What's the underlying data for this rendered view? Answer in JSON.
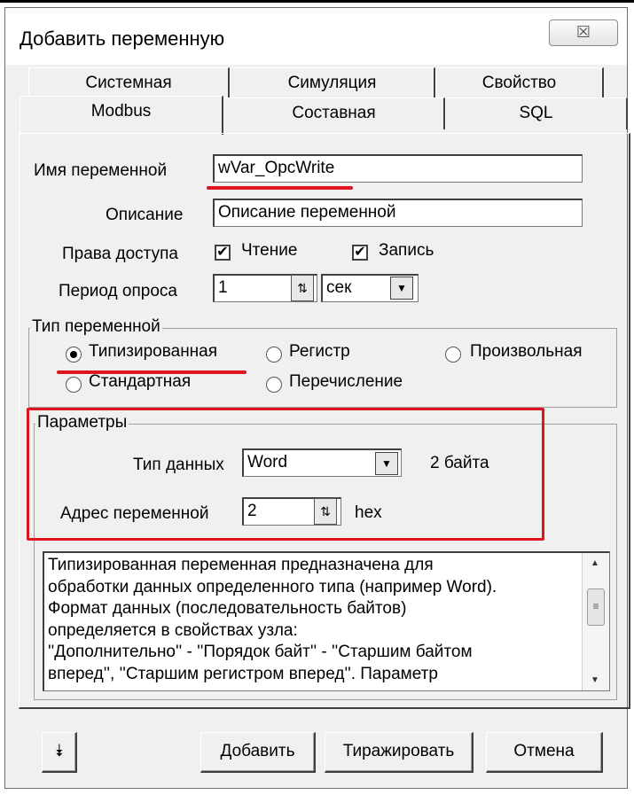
{
  "window": {
    "title": "Добавить переменную",
    "close_symbol": "☒"
  },
  "tabs": {
    "row1": [
      "Системная",
      "Симуляция",
      "Свойство"
    ],
    "row2": [
      "Modbus",
      "Составная",
      "SQL"
    ],
    "active": "Modbus"
  },
  "form": {
    "name_label": "Имя переменной",
    "name_value": "wVar_OpcWrite",
    "desc_label": "Описание",
    "desc_value": "Описание переменной",
    "access_label": "Права доступа",
    "read_label": "Чтение",
    "write_label": "Запись",
    "read_checked": true,
    "write_checked": true,
    "period_label": "Период опроса",
    "period_value": "1",
    "period_unit": "сек"
  },
  "var_type": {
    "title": "Тип переменной",
    "options": [
      "Типизированная",
      "Регистр",
      "Произвольная",
      "Стандартная",
      "Перечисление"
    ],
    "selected": "Типизированная"
  },
  "params": {
    "title": "Параметры",
    "data_type_label": "Тип данных",
    "data_type_value": "Word",
    "size_text": "2 байта",
    "address_label": "Адрес переменной",
    "address_value": "2",
    "address_unit": "hex"
  },
  "description_box": {
    "lines": [
      "Типизированная переменная предназначена для",
      "обработки данных определенного типа (например Word).",
      "Формат данных (последовательность байтов)",
      "определяется в свойствах узла:",
      "''Дополнительно'' - ''Порядок байт'' - ''Старшим байтом",
      "вперед'', ''Старшим регистром вперед''. Параметр"
    ]
  },
  "buttons": {
    "expand_symbol": "⯯",
    "add": "Добавить",
    "replicate": "Тиражировать",
    "cancel": "Отмена"
  },
  "colors": {
    "highlight": "#e0141e",
    "dialog_bg": "#f0f0f0"
  }
}
